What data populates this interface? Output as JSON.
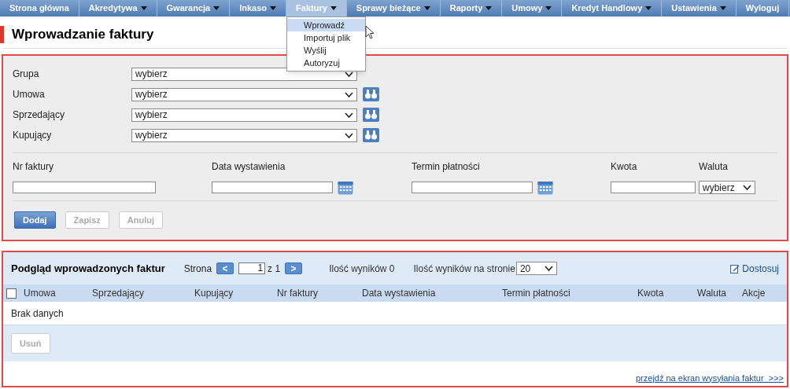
{
  "nav": {
    "items": [
      {
        "label": "Strona główna",
        "has_menu": false,
        "selected": false
      },
      {
        "label": "Akredytywa",
        "has_menu": true,
        "selected": false
      },
      {
        "label": "Gwarancja",
        "has_menu": true,
        "selected": false
      },
      {
        "label": "Inkaso",
        "has_menu": true,
        "selected": false
      },
      {
        "label": "Faktury",
        "has_menu": true,
        "selected": true,
        "menu": [
          {
            "label": "Wprowadź",
            "selected": true
          },
          {
            "label": "Importuj plik",
            "selected": false
          },
          {
            "label": "Wyślij",
            "selected": false
          },
          {
            "label": "Autoryzuj",
            "selected": false
          }
        ]
      },
      {
        "label": "Sprawy bieżące",
        "has_menu": true,
        "selected": false
      },
      {
        "label": "Raporty",
        "has_menu": true,
        "selected": false
      },
      {
        "label": "Umowy",
        "has_menu": true,
        "selected": false
      },
      {
        "label": "Kredyt Handlowy",
        "has_menu": true,
        "selected": false
      }
    ],
    "right_items": [
      {
        "label": "Ustawienia",
        "has_menu": true,
        "selected": false
      },
      {
        "label": "Wyloguj",
        "has_menu": false,
        "selected": false
      }
    ]
  },
  "page_title": "Wprowadzanie faktury",
  "form": {
    "selects": [
      {
        "label": "Grupa",
        "value": "wybierz",
        "lookup": false
      },
      {
        "label": "Umowa",
        "value": "wybierz",
        "lookup": true
      },
      {
        "label": "Sprzedający",
        "value": "wybierz",
        "lookup": true
      },
      {
        "label": "Kupujący",
        "value": "wybierz",
        "lookup": true
      }
    ],
    "fields": [
      {
        "label": "Nr faktury",
        "kind": "text"
      },
      {
        "label": "Data wystawienia",
        "kind": "date"
      },
      {
        "label": "Termin płatności",
        "kind": "date"
      },
      {
        "label": "Kwota",
        "kind": "amount"
      },
      {
        "label": "Waluta",
        "kind": "select",
        "value": "wybierz"
      }
    ],
    "buttons": [
      {
        "label": "Dodaj",
        "disabled": false
      },
      {
        "label": "Zapisz",
        "disabled": true
      },
      {
        "label": "Anuluj",
        "disabled": true
      }
    ]
  },
  "list": {
    "title": "Podgląd wprowadzonych faktur",
    "page_label": "Strona",
    "page": "1",
    "page_of": "z 1",
    "prev": "<",
    "next": ">",
    "results": "Ilość wyników 0",
    "per_page_label": "Ilość wyników na stronie",
    "per_page": "20",
    "customize": "Dostosuj",
    "select_all": {
      "checked": false
    },
    "columns": [
      "Umowa",
      "Sprzedający",
      "Kupujący",
      "Nr faktury",
      "Data wystawienia",
      "Termin płatności",
      "Kwota",
      "Waluta",
      "Akcje"
    ],
    "empty": "Brak danych",
    "buttons": [
      {
        "label": "Usuń",
        "disabled": true
      }
    ],
    "footer_link": "przejdź na ekran wysyłania faktur  >>>"
  }
}
